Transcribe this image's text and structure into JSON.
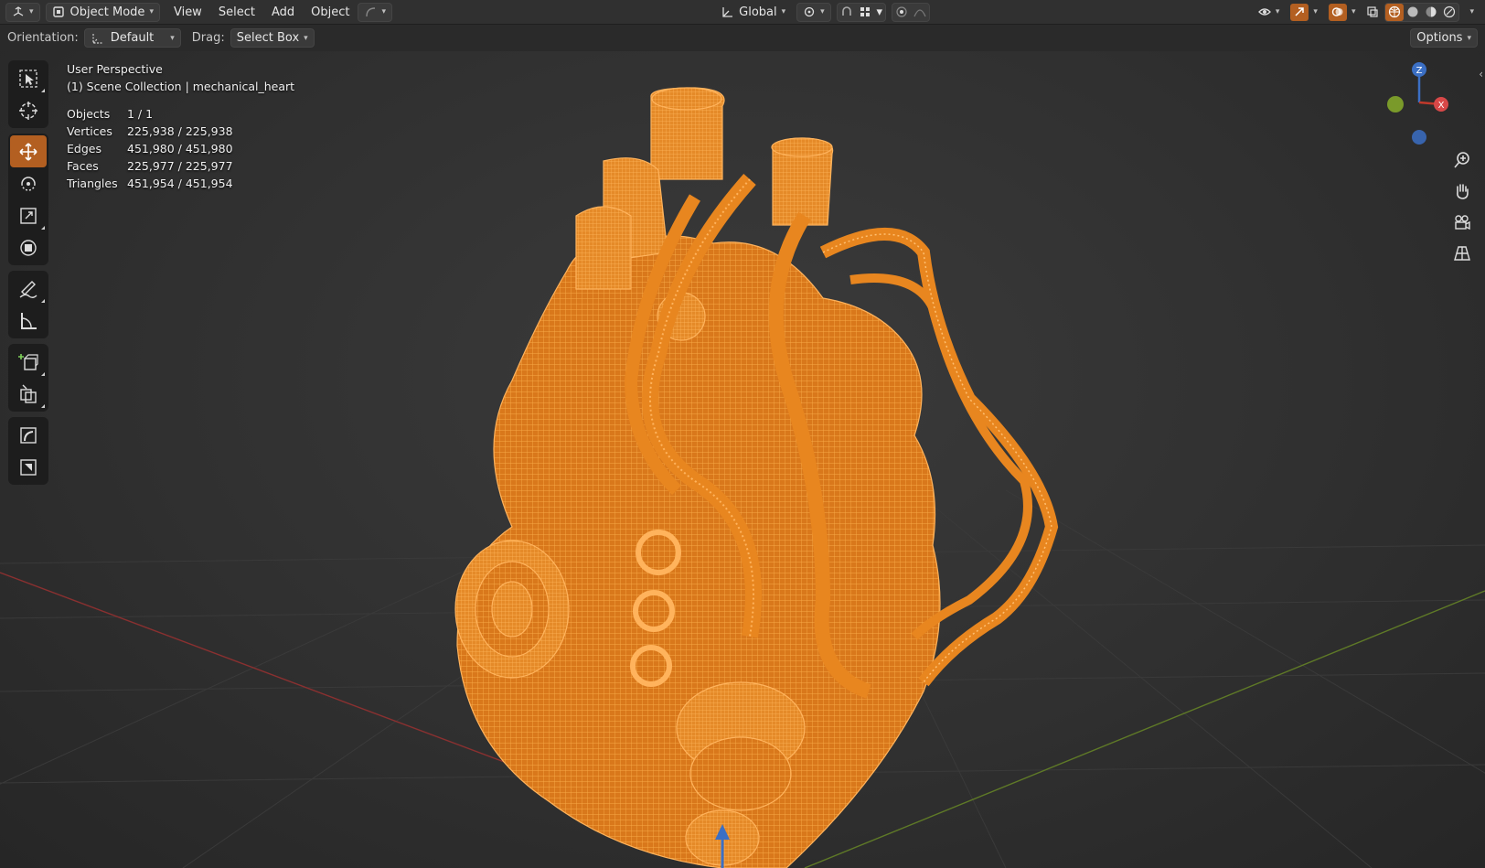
{
  "header": {
    "mode": "Object Mode",
    "menus": [
      "View",
      "Select",
      "Add",
      "Object"
    ],
    "transform_orientation": "Global",
    "options_label": "Options"
  },
  "tool_header": {
    "orientation_label": "Orientation:",
    "orientation_value": "Default",
    "drag_label": "Drag:",
    "drag_value": "Select Box"
  },
  "overlay": {
    "view_name": "User Perspective",
    "collection": "(1) Scene Collection | mechanical_heart",
    "stats": [
      {
        "label": "Objects",
        "value": "1 / 1"
      },
      {
        "label": "Vertices",
        "value": "225,938 / 225,938"
      },
      {
        "label": "Edges",
        "value": "451,980 / 451,980"
      },
      {
        "label": "Faces",
        "value": "225,977 / 225,977"
      },
      {
        "label": "Triangles",
        "value": "451,954 / 451,954"
      }
    ]
  },
  "gizmo": {
    "z": "Z",
    "x": "X",
    "y": "Y"
  },
  "colors": {
    "accent_active_tool": "#b35f21",
    "wireframe_orange": "#f0962a",
    "axis_x": "#c0392b",
    "axis_y": "#6f8f2a",
    "axis_z": "#3b6fc4"
  },
  "tools": [
    "select-box-icon",
    "cursor-icon",
    "move-icon",
    "rotate-icon",
    "scale-icon",
    "transform-icon",
    "annotate-icon",
    "measure-icon",
    "add-cube-icon",
    "add-object-icon",
    "shear-icon",
    "shrink-icon"
  ]
}
